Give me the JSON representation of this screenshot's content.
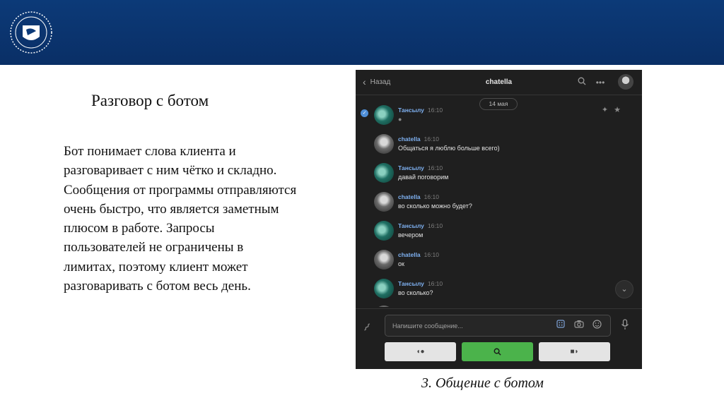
{
  "slide": {
    "title": "Разговор с ботом",
    "body": "Бот понимает слова клиента и разговаривает с ним чётко и складно. Сообщения от программы отправляются очень быстро, что является заметным плюсом в работе. Запросы пользователей не ограничены в лимитах, поэтому клиент может разговаривать с ботом весь день.",
    "caption": "3. Общение с ботом"
  },
  "colors": {
    "header_blue": "#0c3a78",
    "chat_bg": "#1f1f1f",
    "author_blue": "#7eb0f0",
    "button_green": "#4bb34b"
  },
  "chat": {
    "back_label": "Назад",
    "name": "chatella",
    "header_icons": [
      "search-icon",
      "more-icon"
    ],
    "date": "14 мая",
    "messages": [
      {
        "author": "Тансылу",
        "time": "16:10",
        "text": ""
      },
      {
        "author": "chatella",
        "time": "16:10",
        "text": "Общаться я люблю больше всего)"
      },
      {
        "author": "Тансылу",
        "time": "16:10",
        "text": "давай поговорим"
      },
      {
        "author": "chatella",
        "time": "16:10",
        "text": "во сколько можно будет?"
      },
      {
        "author": "Тансылу",
        "time": "16:10",
        "text": "вечером"
      },
      {
        "author": "chatella",
        "time": "16:10",
        "text": "ок"
      },
      {
        "author": "Тансылу",
        "time": "16:10",
        "text": "во сколько?"
      }
    ],
    "input_placeholder": "Напишите сообщение...",
    "keyboard": [
      "voice-icon",
      "search-icon",
      "camera-icon"
    ]
  }
}
